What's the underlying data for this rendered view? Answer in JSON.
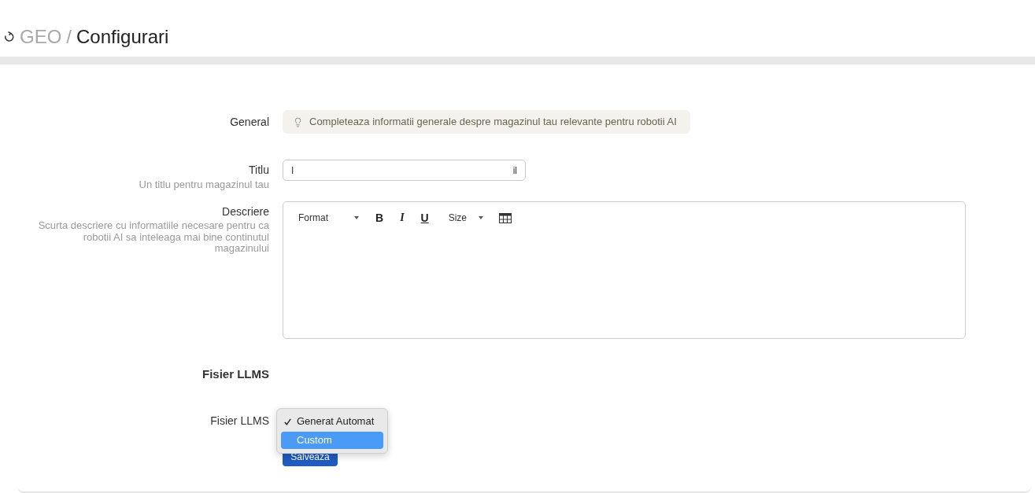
{
  "breadcrumb": {
    "items": [
      {
        "label": "GEO",
        "current": false
      },
      {
        "label": "Configurari",
        "current": true
      }
    ],
    "separator": "/"
  },
  "general_row": {
    "label": "General",
    "hint": "Completeaza informatii generale despre magazinul tau relevante pentru robotii AI"
  },
  "title_field": {
    "label": "Titlu",
    "help": "Un titlu pentru magazinul tau",
    "value_fragments": [
      "I",
      "il"
    ]
  },
  "description_field": {
    "label": "Descriere",
    "help": "Scurta descriere cu informatiile necesare pentru ca robotii AI sa inteleaga mai bine continutul magazinului",
    "toolbar": [
      {
        "kind": "dropdown",
        "label": "Format"
      },
      {
        "kind": "bold",
        "label": "B"
      },
      {
        "kind": "italic",
        "label": "I"
      },
      {
        "kind": "underline",
        "label": "U"
      },
      {
        "kind": "dropdown",
        "label": "Size"
      },
      {
        "kind": "table"
      }
    ]
  },
  "llms_section": {
    "heading": "Fisier LLMS",
    "field_label": "Fisier LLMS",
    "menu_options": [
      {
        "label": "Generat Automat",
        "checked": true,
        "selected": false
      },
      {
        "label": "Custom",
        "checked": false,
        "selected": true
      }
    ]
  },
  "save_button": {
    "label": "Salveaza"
  }
}
